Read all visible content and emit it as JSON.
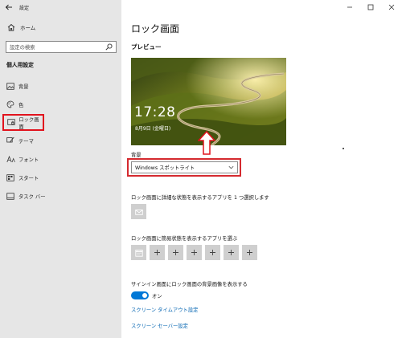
{
  "window": {
    "title": "設定",
    "back_icon": "arrow-left-icon",
    "controls": [
      "minimize-icon",
      "maximize-icon",
      "close-icon"
    ]
  },
  "sidebar": {
    "home": {
      "label": "ホーム",
      "icon": "home-icon"
    },
    "search": {
      "placeholder": "設定の検索",
      "icon": "search-icon"
    },
    "section_title": "個人用設定",
    "items": [
      {
        "label": "背景",
        "icon": "picture-icon",
        "selected": false
      },
      {
        "label": "色",
        "icon": "palette-icon",
        "selected": false
      },
      {
        "label": "ロック画面",
        "icon": "lock-screen-icon",
        "selected": true
      },
      {
        "label": "テーマ",
        "icon": "brush-icon",
        "selected": false
      },
      {
        "label": "フォント",
        "icon": "font-icon",
        "selected": false
      },
      {
        "label": "スタート",
        "icon": "start-icon",
        "selected": false
      },
      {
        "label": "タスク バー",
        "icon": "taskbar-icon",
        "selected": false
      }
    ]
  },
  "main": {
    "page_title": "ロック画面",
    "preview_label": "プレビュー",
    "preview": {
      "time": "17:28",
      "date": "8月9日 (金曜日)"
    },
    "background": {
      "label": "背景",
      "selected_value": "Windows スポットライト"
    },
    "detailed_status": {
      "label": "ロック画面に詳細な状態を表示するアプリを 1 つ選択します",
      "app_icon": "mail-icon"
    },
    "quick_status": {
      "label": "ロック画面に簡易状態を表示するアプリを選ぶ",
      "tiles": [
        "calendar-icon",
        "plus-icon",
        "plus-icon",
        "plus-icon",
        "plus-icon",
        "plus-icon",
        "plus-icon"
      ]
    },
    "signin_background": {
      "label": "サインイン画面にロック画面の背景画像を表示する",
      "toggle_label": "オン",
      "enabled": true
    },
    "links": {
      "timeout": "スクリーン タイムアウト設定",
      "screensaver": "スクリーン セーバー設定"
    }
  },
  "colors": {
    "accent": "#0078d7",
    "highlight_frame": "#e1131d",
    "link": "#0063b1",
    "sidebar_bg": "#e6e6e6"
  }
}
